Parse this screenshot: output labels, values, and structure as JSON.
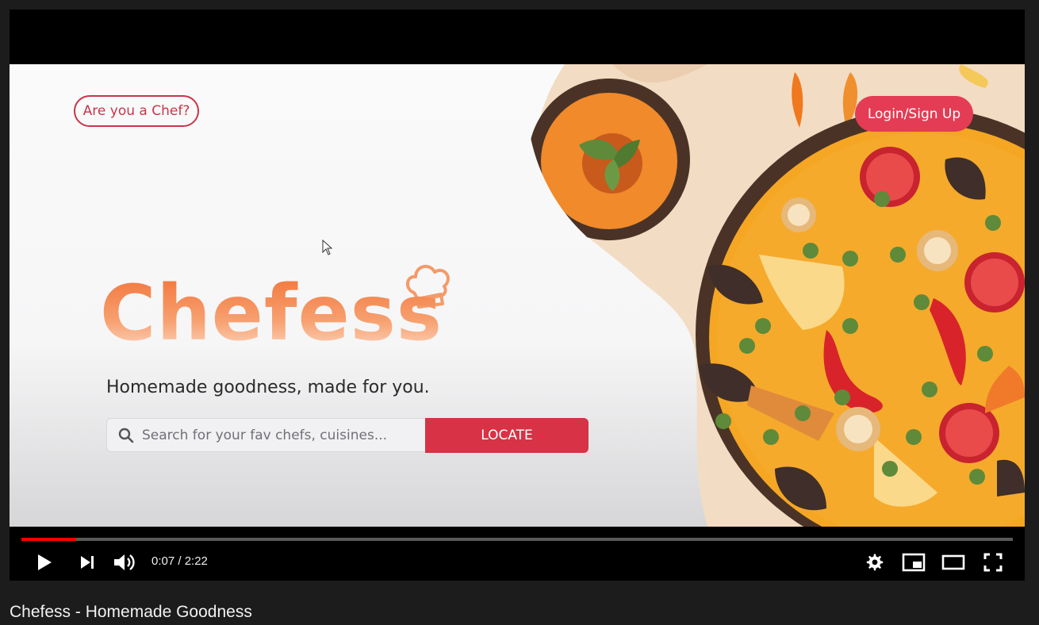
{
  "video": {
    "title": "Chefess - Homemade Goodness",
    "time_display": "0:07 / 2:22",
    "progress_fraction": 0.0555
  },
  "site": {
    "chef_button": "Are you a Chef?",
    "login_button": "Login/Sign Up",
    "logo_text": "Chefess",
    "tagline": "Homemade goodness, made for you.",
    "search_placeholder": "Search for your fav chefs, cuisines...",
    "locate_button": "LOCATE"
  },
  "colors": {
    "brand_red": "#e43c54",
    "logo_orange": "#f6955e",
    "progress_red": "#ff0000"
  },
  "icons": {
    "play": "play-icon",
    "next": "next-icon",
    "volume": "volume-icon",
    "settings": "settings-gear-icon",
    "miniplayer": "miniplayer-icon",
    "theater": "theater-mode-icon",
    "fullscreen": "fullscreen-icon",
    "search": "search-icon"
  }
}
